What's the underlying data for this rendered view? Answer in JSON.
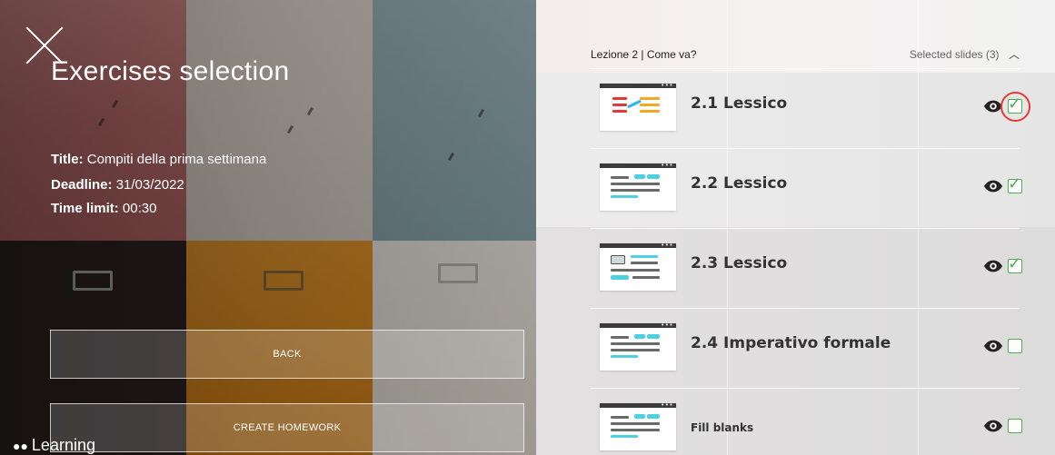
{
  "left": {
    "title": "Exercises selection",
    "info": {
      "title_label": "Title:",
      "title_value": "Compiti della prima settimana",
      "deadline_label": "Deadline:",
      "deadline_value": "31/03/2022",
      "time_label": "Time limit:",
      "time_value": "00:30"
    },
    "buttons": {
      "back": "BACK",
      "create": "CREATE HOMEWORK"
    },
    "brand": "Learning"
  },
  "right": {
    "lesson": "Lezione 2 | Come va?",
    "selected": "Selected slides (3)",
    "items": [
      {
        "label": "2.1 Lessico",
        "checked": true
      },
      {
        "label": "2.2 Lessico",
        "checked": true
      },
      {
        "label": "2.3 Lessico",
        "checked": true
      },
      {
        "label": "2.4 Imperativo formale",
        "checked": false
      },
      {
        "label": "Fill blanks",
        "checked": false
      }
    ]
  },
  "colors": {
    "check": "#4caf50",
    "highlight_ring": "#e53935"
  },
  "icons": [
    "close-icon",
    "eye-icon",
    "checkbox-icon",
    "chevron-up-icon"
  ]
}
